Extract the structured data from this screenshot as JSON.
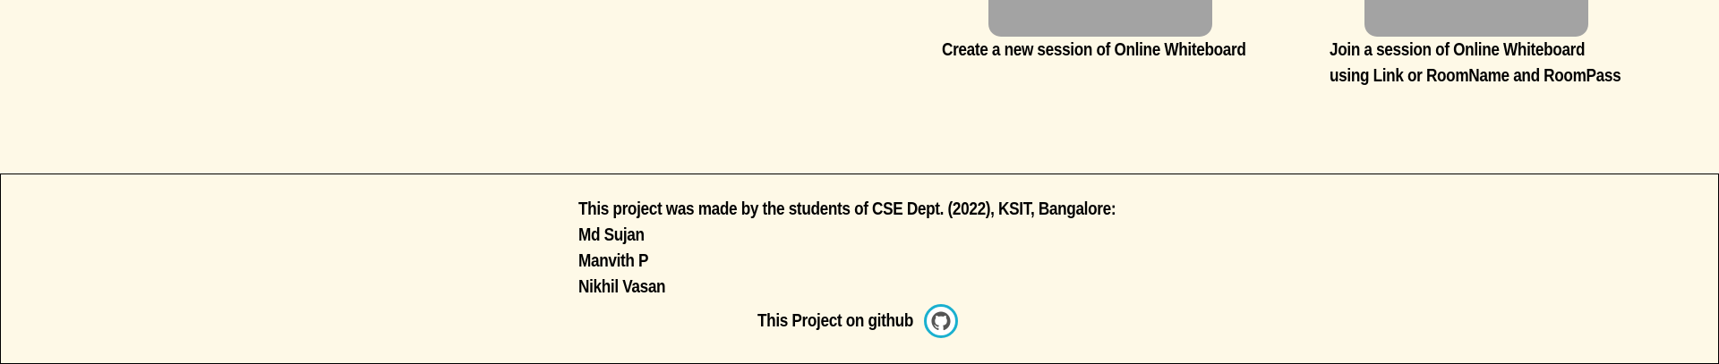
{
  "sessions": {
    "create": {
      "caption_lines": [
        "Create a new session of Online Whiteboard"
      ]
    },
    "join": {
      "caption_lines": [
        "Join a session of Online Whiteboard",
        "using Link or RoomName and RoomPass"
      ]
    }
  },
  "footer": {
    "intro": "This project was made by the students of CSE Dept. (2022), KSIT, Bangalore:",
    "authors": [
      "Md Sujan",
      "Manvith P",
      "Nikhil Vasan"
    ],
    "github_text": "This Project on github",
    "github_icon": "github-octocat-icon"
  },
  "colors": {
    "background": "#fef9e7",
    "button": "#a3a3a3",
    "github_ring": "#1ab0cf",
    "github_icon": "#555555"
  }
}
